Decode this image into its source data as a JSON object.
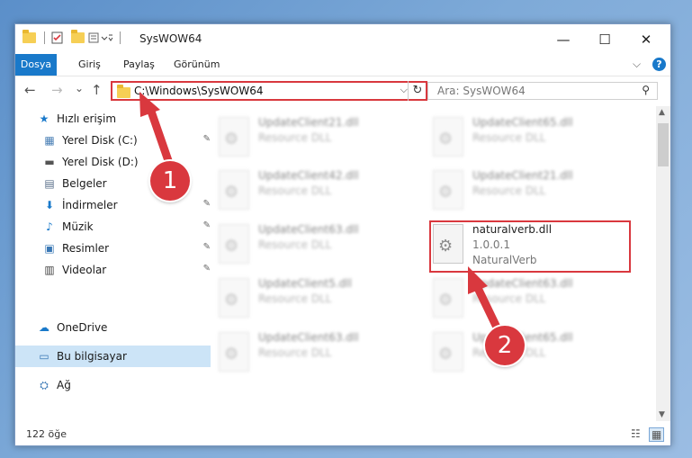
{
  "window": {
    "title": "SysWOW64",
    "minimize": "—",
    "maximize": "☐",
    "close": "✕"
  },
  "ribbon": {
    "tabs": [
      "Dosya",
      "Giriş",
      "Paylaş",
      "Görünüm"
    ],
    "collapse": "⌵",
    "help": "?"
  },
  "nav": {
    "back": "←",
    "forward": "→",
    "recent": "⌄",
    "up": "↑"
  },
  "address": {
    "path": "C:\\Windows\\SysWOW64",
    "dropdown": "⌵",
    "refresh": "↻"
  },
  "search": {
    "placeholder": "Ara: SysWOW64",
    "icon": "⚲"
  },
  "sidebar": {
    "items": [
      {
        "label": "Hızlı erişim",
        "icon": "★"
      },
      {
        "label": "Yerel Disk (C:)",
        "icon": "▦"
      },
      {
        "label": "Yerel Disk (D:)",
        "icon": "▬"
      },
      {
        "label": "Belgeler",
        "icon": "▤"
      },
      {
        "label": "İndirmeler",
        "icon": "⬇"
      },
      {
        "label": "Müzik",
        "icon": "♪"
      },
      {
        "label": "Resimler",
        "icon": "▣"
      },
      {
        "label": "Videolar",
        "icon": "▥"
      },
      {
        "label": "OneDrive",
        "icon": "☁"
      },
      {
        "label": "Bu bilgisayar",
        "icon": "▭"
      },
      {
        "label": "Ağ",
        "icon": "⛭"
      }
    ],
    "pin": "✎"
  },
  "files": [
    {
      "name": "UpdateClient21.dll",
      "desc": "Resource DLL"
    },
    {
      "name": "UpdateClient65.dll",
      "desc": "Resource DLL"
    },
    {
      "name": "UpdateClient42.dll",
      "desc": "Resource DLL"
    },
    {
      "name": "UpdateClient21.dll",
      "desc": "Resource DLL"
    },
    {
      "name": "UpdateClient63.dll",
      "desc": "Resource DLL"
    },
    {
      "name": "naturalverb.dll",
      "version": "1.0.0.1",
      "company": "NaturalVerb"
    },
    {
      "name": "UpdateClient5.dll",
      "desc": "Resource DLL"
    },
    {
      "name": "UpdateClient63.dll",
      "desc": "Resource DLL"
    },
    {
      "name": "UpdateClient63.dll",
      "desc": "Resource DLL"
    },
    {
      "name": "UpdateClient65.dll",
      "desc": "Resource DLL"
    }
  ],
  "gear": "⚙",
  "status": {
    "count": "122 öğe",
    "details_view": "☷",
    "tiles_view": "▦"
  },
  "scroll": {
    "up": "▲",
    "down": "▼"
  },
  "annotations": {
    "one": "1",
    "two": "2"
  },
  "colors": {
    "accent": "#1979ca",
    "highlight": "#d9383e",
    "selection": "#cce4f7"
  }
}
